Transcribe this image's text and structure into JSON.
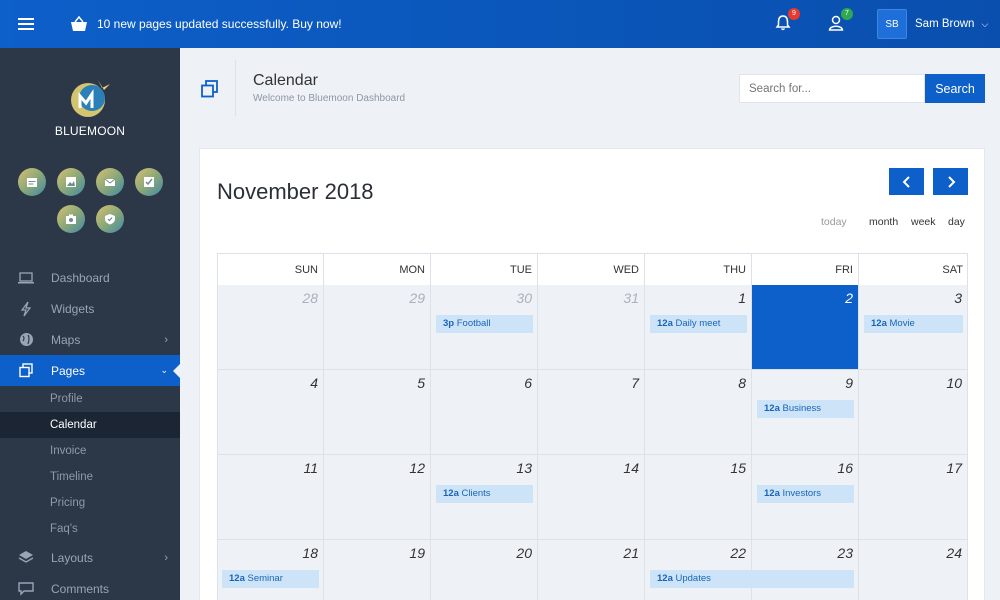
{
  "topbar": {
    "notification_text": "10 new pages updated successfully. Buy now!",
    "alerts_count": "9",
    "users_count": "7",
    "user_initials": "SB",
    "user_name": "Sam Brown"
  },
  "sidebar": {
    "brand": "BLUEMOON",
    "quick_icons": [
      "calendar-icon",
      "image-icon",
      "mail-icon",
      "checkbox-icon",
      "camera-icon",
      "shield-icon"
    ],
    "nav": [
      {
        "label": "Dashboard",
        "icon": "laptop-icon"
      },
      {
        "label": "Widgets",
        "icon": "bolt-icon"
      },
      {
        "label": "Maps",
        "icon": "globe-icon",
        "has_children": true
      },
      {
        "label": "Pages",
        "icon": "pages-icon",
        "has_children": true,
        "active": true
      },
      {
        "label": "Layouts",
        "icon": "layers-icon",
        "has_children": true
      },
      {
        "label": "Comments",
        "icon": "comment-icon"
      }
    ],
    "subnav": [
      {
        "label": "Profile"
      },
      {
        "label": "Calendar",
        "active": true
      },
      {
        "label": "Invoice"
      },
      {
        "label": "Timeline"
      },
      {
        "label": "Pricing"
      },
      {
        "label": "Faq's"
      }
    ]
  },
  "header": {
    "title": "Calendar",
    "subtitle": "Welcome to Bluemoon Dashboard",
    "search_placeholder": "Search for...",
    "search_button": "Search"
  },
  "calendar": {
    "month_title": "November 2018",
    "prev_icon": "chevron-left-icon",
    "next_icon": "chevron-right-icon",
    "views": [
      "today",
      "month",
      "week",
      "day"
    ],
    "weekdays": [
      "SUN",
      "MON",
      "TUE",
      "WED",
      "THU",
      "FRI",
      "SAT"
    ],
    "weeks": [
      [
        {
          "day": "28",
          "other": true
        },
        {
          "day": "29",
          "other": true
        },
        {
          "day": "30",
          "other": true,
          "event": {
            "time": "3p",
            "title": "Football"
          }
        },
        {
          "day": "31",
          "other": true
        },
        {
          "day": "1",
          "event": {
            "time": "12a",
            "title": "Daily meet"
          }
        },
        {
          "day": "2",
          "today": true
        },
        {
          "day": "3",
          "event": {
            "time": "12a",
            "title": "Movie"
          }
        }
      ],
      [
        {
          "day": "4"
        },
        {
          "day": "5"
        },
        {
          "day": "6"
        },
        {
          "day": "7"
        },
        {
          "day": "8"
        },
        {
          "day": "9",
          "event": {
            "time": "12a",
            "title": "Business"
          }
        },
        {
          "day": "10"
        }
      ],
      [
        {
          "day": "11"
        },
        {
          "day": "12"
        },
        {
          "day": "13",
          "event": {
            "time": "12a",
            "title": "Clients"
          }
        },
        {
          "day": "14"
        },
        {
          "day": "15"
        },
        {
          "day": "16",
          "event": {
            "time": "12a",
            "title": "Investors"
          }
        },
        {
          "day": "17"
        }
      ],
      [
        {
          "day": "18",
          "event": {
            "time": "12a",
            "title": "Seminar"
          }
        },
        {
          "day": "19"
        },
        {
          "day": "20"
        },
        {
          "day": "21"
        },
        {
          "day": "22",
          "event": {
            "time": "12a",
            "title": "Updates",
            "span": 2
          }
        },
        {
          "day": "23"
        },
        {
          "day": "24"
        }
      ]
    ]
  },
  "colors": {
    "primary": "#0d5fc9",
    "sidebar_bg": "#2c3748",
    "event_bg": "#cde4f8",
    "event_text": "#1a64b8"
  }
}
